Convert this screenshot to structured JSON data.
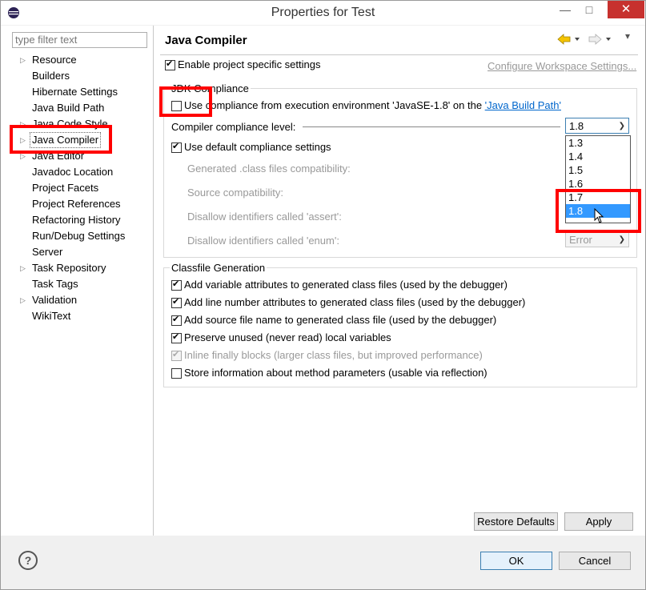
{
  "window": {
    "title": "Properties for Test",
    "minimize": "—",
    "maximize": "□",
    "close": "✕"
  },
  "filter": {
    "placeholder": "type filter text"
  },
  "tree": [
    {
      "label": "Resource",
      "arrow": true
    },
    {
      "label": "Builders",
      "arrow": false
    },
    {
      "label": "Hibernate Settings",
      "arrow": false
    },
    {
      "label": "Java Build Path",
      "arrow": false
    },
    {
      "label": "Java Code Style",
      "arrow": true
    },
    {
      "label": "Java Compiler",
      "arrow": true,
      "selected": true
    },
    {
      "label": "Java Editor",
      "arrow": true
    },
    {
      "label": "Javadoc Location",
      "arrow": false
    },
    {
      "label": "Project Facets",
      "arrow": false
    },
    {
      "label": "Project References",
      "arrow": false
    },
    {
      "label": "Refactoring History",
      "arrow": false
    },
    {
      "label": "Run/Debug Settings",
      "arrow": false
    },
    {
      "label": "Server",
      "arrow": false
    },
    {
      "label": "Task Repository",
      "arrow": true
    },
    {
      "label": "Task Tags",
      "arrow": false
    },
    {
      "label": "Validation",
      "arrow": true
    },
    {
      "label": "WikiText",
      "arrow": false
    }
  ],
  "page": {
    "title": "Java Compiler",
    "enable_specific": "Enable project specific settings",
    "configure_link": "Configure Workspace Settings...",
    "jdk_group": "JDK Compliance",
    "use_env": "Use compliance from execution environment 'JavaSE-1.8' on the ",
    "build_path_link": "'Java Build Path'",
    "compliance_level": "Compiler compliance level:",
    "compliance_value": "1.8",
    "use_default": "Use default compliance settings",
    "generated_class": "Generated .class files compatibility:",
    "source_compat": "Source compatibility:",
    "disallow_assert": "Disallow identifiers called 'assert':",
    "disallow_enum": "Disallow identifiers called 'enum':",
    "enum_value": "Error",
    "dropdown_options": [
      "1.3",
      "1.4",
      "1.5",
      "1.6",
      "1.7",
      "1.8"
    ],
    "classfile_group": "Classfile Generation",
    "classfile_options": [
      {
        "label": "Add variable attributes to generated class files (used by the debugger)",
        "checked": true,
        "disabled": false
      },
      {
        "label": "Add line number attributes to generated class files (used by the debugger)",
        "checked": true,
        "disabled": false
      },
      {
        "label": "Add source file name to generated class file (used by the debugger)",
        "checked": true,
        "disabled": false
      },
      {
        "label": "Preserve unused (never read) local variables",
        "checked": true,
        "disabled": false
      },
      {
        "label": "Inline finally blocks (larger class files, but improved performance)",
        "checked": true,
        "disabled": true
      },
      {
        "label": "Store information about method parameters (usable via reflection)",
        "checked": false,
        "disabled": false
      }
    ]
  },
  "buttons": {
    "restore": "Restore Defaults",
    "apply": "Apply",
    "ok": "OK",
    "cancel": "Cancel",
    "help": "?"
  },
  "colors": {
    "highlight": "#3399ff",
    "annotation": "#ff0000",
    "link": "#0066cc"
  }
}
